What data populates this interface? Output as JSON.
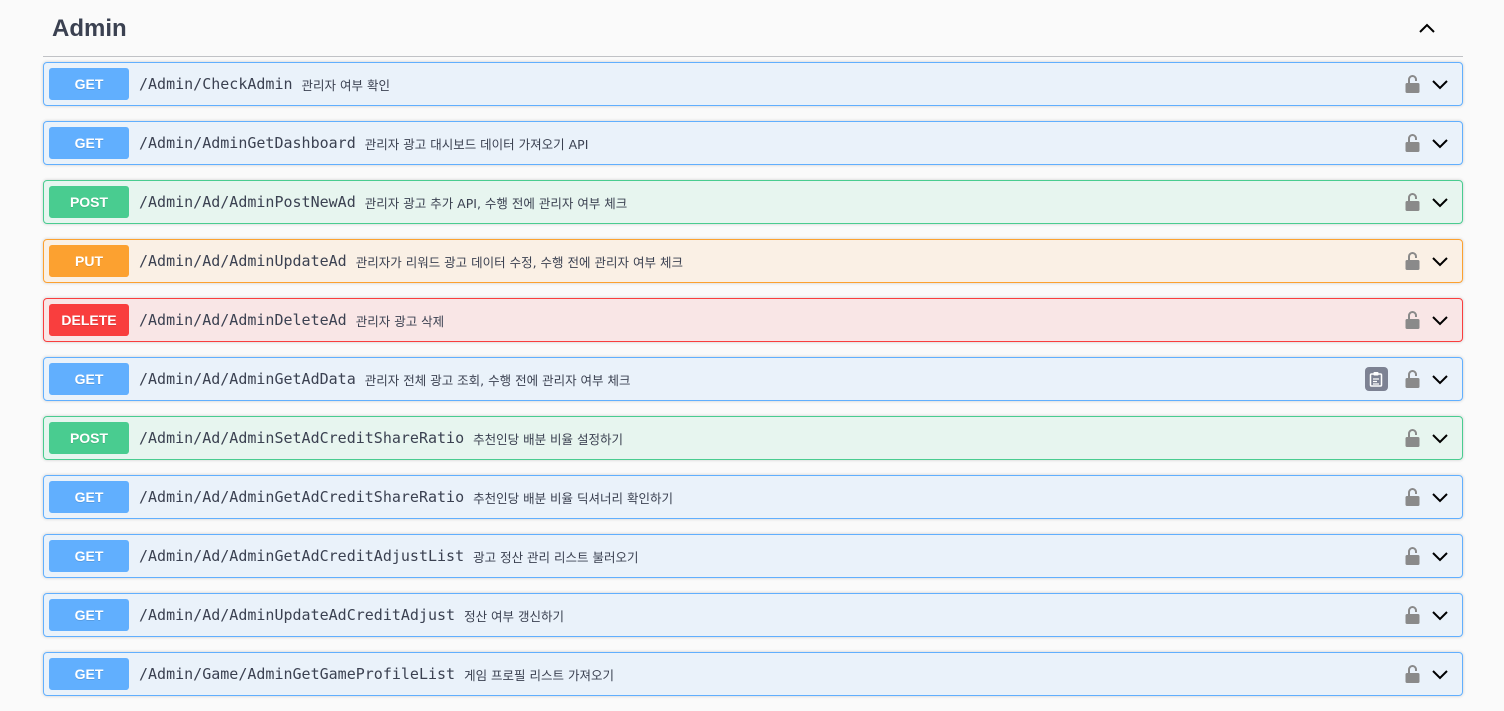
{
  "section": {
    "title": "Admin",
    "collapse_icon": "chevron-up-icon"
  },
  "operations": [
    {
      "method": "GET",
      "kind": "get",
      "path": "/Admin/CheckAdmin",
      "summary": "관리자 여부 확인"
    },
    {
      "method": "GET",
      "kind": "get",
      "path": "/Admin/AdminGetDashboard",
      "summary": "관리자 광고 대시보드 데이터 가져오기 API"
    },
    {
      "method": "POST",
      "kind": "post",
      "path": "/Admin/Ad/AdminPostNewAd",
      "summary": "관리자 광고 추가 API, 수행 전에 관리자 여부 체크"
    },
    {
      "method": "PUT",
      "kind": "put",
      "path": "/Admin/Ad/AdminUpdateAd",
      "summary": "관리자가 리워드 광고 데이터 수정, 수행 전에 관리자 여부 체크"
    },
    {
      "method": "DELETE",
      "kind": "delete",
      "path": "/Admin/Ad/AdminDeleteAd",
      "summary": "관리자 광고 삭제"
    },
    {
      "method": "GET",
      "kind": "get",
      "path": "/Admin/Ad/AdminGetAdData",
      "summary": "관리자 전체 광고 조회, 수행 전에 관리자 여부 체크",
      "copy": true
    },
    {
      "method": "POST",
      "kind": "post",
      "path": "/Admin/Ad/AdminSetAdCreditShareRatio",
      "summary": "추천인당 배분 비율 설정하기"
    },
    {
      "method": "GET",
      "kind": "get",
      "path": "/Admin/Ad/AdminGetAdCreditShareRatio",
      "summary": "추천인당 배분 비율 딕셔너리 확인하기"
    },
    {
      "method": "GET",
      "kind": "get",
      "path": "/Admin/Ad/AdminGetAdCreditAdjustList",
      "summary": "광고 정산 관리 리스트 불러오기"
    },
    {
      "method": "GET",
      "kind": "get",
      "path": "/Admin/Ad/AdminUpdateAdCreditAdjust",
      "summary": "정산 여부 갱신하기"
    },
    {
      "method": "GET",
      "kind": "get",
      "path": "/Admin/Game/AdminGetGameProfileList",
      "summary": "게임 프로필 리스트 가져오기"
    }
  ],
  "colors": {
    "get": "#61affe",
    "post": "#49cc90",
    "put": "#fca130",
    "delete": "#f93e3e",
    "text": "#3b4151"
  }
}
